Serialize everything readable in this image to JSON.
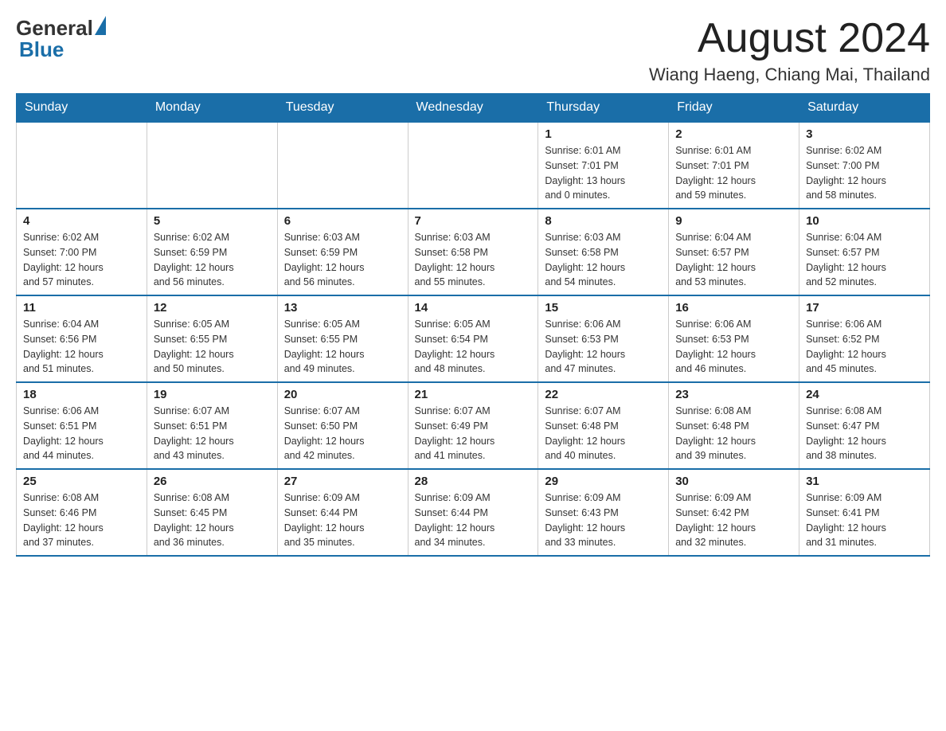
{
  "header": {
    "logo": {
      "text_general": "General",
      "text_blue": "Blue"
    },
    "month_title": "August 2024",
    "location": "Wiang Haeng, Chiang Mai, Thailand"
  },
  "days_of_week": [
    "Sunday",
    "Monday",
    "Tuesday",
    "Wednesday",
    "Thursday",
    "Friday",
    "Saturday"
  ],
  "weeks": [
    [
      {
        "day": "",
        "info": ""
      },
      {
        "day": "",
        "info": ""
      },
      {
        "day": "",
        "info": ""
      },
      {
        "day": "",
        "info": ""
      },
      {
        "day": "1",
        "info": "Sunrise: 6:01 AM\nSunset: 7:01 PM\nDaylight: 13 hours\nand 0 minutes."
      },
      {
        "day": "2",
        "info": "Sunrise: 6:01 AM\nSunset: 7:01 PM\nDaylight: 12 hours\nand 59 minutes."
      },
      {
        "day": "3",
        "info": "Sunrise: 6:02 AM\nSunset: 7:00 PM\nDaylight: 12 hours\nand 58 minutes."
      }
    ],
    [
      {
        "day": "4",
        "info": "Sunrise: 6:02 AM\nSunset: 7:00 PM\nDaylight: 12 hours\nand 57 minutes."
      },
      {
        "day": "5",
        "info": "Sunrise: 6:02 AM\nSunset: 6:59 PM\nDaylight: 12 hours\nand 56 minutes."
      },
      {
        "day": "6",
        "info": "Sunrise: 6:03 AM\nSunset: 6:59 PM\nDaylight: 12 hours\nand 56 minutes."
      },
      {
        "day": "7",
        "info": "Sunrise: 6:03 AM\nSunset: 6:58 PM\nDaylight: 12 hours\nand 55 minutes."
      },
      {
        "day": "8",
        "info": "Sunrise: 6:03 AM\nSunset: 6:58 PM\nDaylight: 12 hours\nand 54 minutes."
      },
      {
        "day": "9",
        "info": "Sunrise: 6:04 AM\nSunset: 6:57 PM\nDaylight: 12 hours\nand 53 minutes."
      },
      {
        "day": "10",
        "info": "Sunrise: 6:04 AM\nSunset: 6:57 PM\nDaylight: 12 hours\nand 52 minutes."
      }
    ],
    [
      {
        "day": "11",
        "info": "Sunrise: 6:04 AM\nSunset: 6:56 PM\nDaylight: 12 hours\nand 51 minutes."
      },
      {
        "day": "12",
        "info": "Sunrise: 6:05 AM\nSunset: 6:55 PM\nDaylight: 12 hours\nand 50 minutes."
      },
      {
        "day": "13",
        "info": "Sunrise: 6:05 AM\nSunset: 6:55 PM\nDaylight: 12 hours\nand 49 minutes."
      },
      {
        "day": "14",
        "info": "Sunrise: 6:05 AM\nSunset: 6:54 PM\nDaylight: 12 hours\nand 48 minutes."
      },
      {
        "day": "15",
        "info": "Sunrise: 6:06 AM\nSunset: 6:53 PM\nDaylight: 12 hours\nand 47 minutes."
      },
      {
        "day": "16",
        "info": "Sunrise: 6:06 AM\nSunset: 6:53 PM\nDaylight: 12 hours\nand 46 minutes."
      },
      {
        "day": "17",
        "info": "Sunrise: 6:06 AM\nSunset: 6:52 PM\nDaylight: 12 hours\nand 45 minutes."
      }
    ],
    [
      {
        "day": "18",
        "info": "Sunrise: 6:06 AM\nSunset: 6:51 PM\nDaylight: 12 hours\nand 44 minutes."
      },
      {
        "day": "19",
        "info": "Sunrise: 6:07 AM\nSunset: 6:51 PM\nDaylight: 12 hours\nand 43 minutes."
      },
      {
        "day": "20",
        "info": "Sunrise: 6:07 AM\nSunset: 6:50 PM\nDaylight: 12 hours\nand 42 minutes."
      },
      {
        "day": "21",
        "info": "Sunrise: 6:07 AM\nSunset: 6:49 PM\nDaylight: 12 hours\nand 41 minutes."
      },
      {
        "day": "22",
        "info": "Sunrise: 6:07 AM\nSunset: 6:48 PM\nDaylight: 12 hours\nand 40 minutes."
      },
      {
        "day": "23",
        "info": "Sunrise: 6:08 AM\nSunset: 6:48 PM\nDaylight: 12 hours\nand 39 minutes."
      },
      {
        "day": "24",
        "info": "Sunrise: 6:08 AM\nSunset: 6:47 PM\nDaylight: 12 hours\nand 38 minutes."
      }
    ],
    [
      {
        "day": "25",
        "info": "Sunrise: 6:08 AM\nSunset: 6:46 PM\nDaylight: 12 hours\nand 37 minutes."
      },
      {
        "day": "26",
        "info": "Sunrise: 6:08 AM\nSunset: 6:45 PM\nDaylight: 12 hours\nand 36 minutes."
      },
      {
        "day": "27",
        "info": "Sunrise: 6:09 AM\nSunset: 6:44 PM\nDaylight: 12 hours\nand 35 minutes."
      },
      {
        "day": "28",
        "info": "Sunrise: 6:09 AM\nSunset: 6:44 PM\nDaylight: 12 hours\nand 34 minutes."
      },
      {
        "day": "29",
        "info": "Sunrise: 6:09 AM\nSunset: 6:43 PM\nDaylight: 12 hours\nand 33 minutes."
      },
      {
        "day": "30",
        "info": "Sunrise: 6:09 AM\nSunset: 6:42 PM\nDaylight: 12 hours\nand 32 minutes."
      },
      {
        "day": "31",
        "info": "Sunrise: 6:09 AM\nSunset: 6:41 PM\nDaylight: 12 hours\nand 31 minutes."
      }
    ]
  ]
}
